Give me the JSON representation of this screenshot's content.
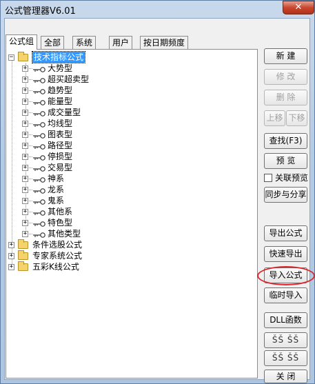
{
  "window": {
    "title": "公式管理器V6.01",
    "close_glyph": "✕"
  },
  "tabs": [
    {
      "label": "公式组"
    },
    {
      "label": "全部"
    },
    {
      "label": "系统"
    },
    {
      "label": "用户"
    },
    {
      "label": "按日期频度"
    }
  ],
  "tree": {
    "root": {
      "label": "技术指标公式",
      "expander": "−"
    },
    "children": [
      {
        "label": "大势型"
      },
      {
        "label": "超买超卖型"
      },
      {
        "label": "趋势型"
      },
      {
        "label": "能量型"
      },
      {
        "label": "成交量型"
      },
      {
        "label": "均线型"
      },
      {
        "label": "图表型"
      },
      {
        "label": "路径型"
      },
      {
        "label": "停损型"
      },
      {
        "label": "交易型"
      },
      {
        "label": "神系"
      },
      {
        "label": "龙系"
      },
      {
        "label": "鬼系"
      },
      {
        "label": "其他系"
      },
      {
        "label": "特色型"
      },
      {
        "label": "其他类型"
      }
    ],
    "siblings": [
      {
        "label": "条件选股公式"
      },
      {
        "label": "专家系统公式"
      },
      {
        "label": "五彩K线公式"
      }
    ],
    "expander_plus": "+"
  },
  "buttons": {
    "new": "新 建",
    "modify": "修 改",
    "delete": "删 除",
    "move_up": "上移",
    "move_down": "下移",
    "find": "查找(F3)",
    "preview": "预 览",
    "linked_preview": "关联预览",
    "sync_share": "同步与分享",
    "export": "导出公式",
    "quick_export": "快速导出",
    "import": "导入公式",
    "temp_import": "临时导入",
    "dll": "DLL函数",
    "garbled_1": "ŠŠ ŠŠ",
    "garbled_2": "ŠŠ ŠŠ",
    "close": "关 闭"
  },
  "colors": {
    "selection": "#3399ff",
    "annotation": "#e0242b",
    "folder": "#f4d36a"
  }
}
